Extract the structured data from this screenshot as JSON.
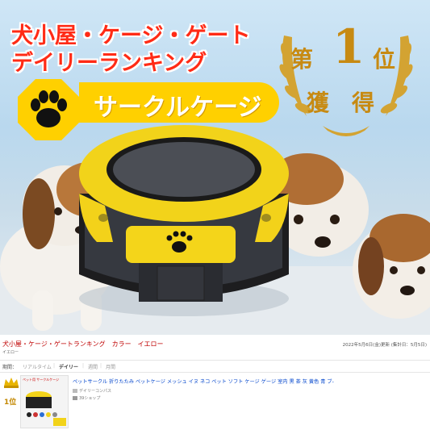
{
  "banner": {
    "title_line1": "犬小屋・ケージ・ゲート",
    "title_line2": "デイリーランキング",
    "category_label": "サークルケージ",
    "award": {
      "dai": "第",
      "rank": "1",
      "i": "位",
      "kaku": "獲",
      "toku": "得"
    },
    "colors": {
      "title": "#ff2b16",
      "label_bg": "#ffd000",
      "award_gold": "#c78a12"
    }
  },
  "ranking": {
    "title": "犬小屋・ケージ・ゲートランキング　カラー　イエロー",
    "sub": "イエロー",
    "date": "2022年5月6日(金)更新 (集計日：5月5日)",
    "period_label": "期間：",
    "tabs": [
      "リアルタイム",
      "デイリー",
      "週間",
      "月間"
    ],
    "active_tab": "デイリー",
    "rank": "1位",
    "thumb_label": "ペット用 サークルケージ",
    "product_title": "ペットサークル 折りたたみ ペットケージ メッシュ イヌ ネコ ペット ソフト ケージ ゲージ 室内 黒 茶 灰 黄色 青 ブ-",
    "shop": "デイリーコンパス",
    "reviews": "39ショップ"
  }
}
